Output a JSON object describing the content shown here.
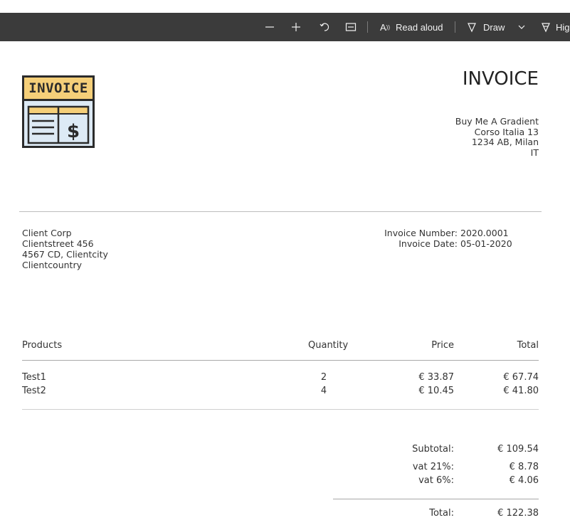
{
  "toolbar": {
    "read_aloud_label": "Read aloud",
    "draw_label": "Draw",
    "highlight_label": "Hig",
    "icons": [
      "zoom-out-icon",
      "zoom-in-icon",
      "rotate-icon",
      "fit-page-icon",
      "read-aloud-icon",
      "draw-icon",
      "chevron-down-icon",
      "highlight-icon"
    ]
  },
  "logo": {
    "text": "INVOICE",
    "accent": "#f5cf79",
    "body": "#ddeaf5"
  },
  "document": {
    "title": "INVOICE",
    "seller": {
      "name": "Buy Me A Gradient",
      "street": "Corso Italia 13",
      "city": "1234 AB, Milan",
      "country": "IT"
    },
    "client": {
      "name": "Client Corp",
      "street": "Clientstreet 456",
      "city": "4567 CD, Clientcity",
      "country": "Clientcountry"
    },
    "meta": {
      "invoice_number_label": "Invoice Number:",
      "invoice_number": "2020.0001",
      "invoice_date_label": "Invoice Date:",
      "invoice_date": "05-01-2020"
    },
    "table": {
      "headers": {
        "products": "Products",
        "quantity": "Quantity",
        "price": "Price",
        "total": "Total"
      },
      "rows": [
        {
          "product": "Test1",
          "quantity": "2",
          "price": "€ 33.87",
          "total": "€ 67.74"
        },
        {
          "product": "Test2",
          "quantity": "4",
          "price": "€ 10.45",
          "total": "€ 41.80"
        }
      ]
    },
    "totals": {
      "subtotal_label": "Subtotal:",
      "subtotal": "€ 109.54",
      "vat21_label": "vat 21%:",
      "vat21": "€ 8.78",
      "vat6_label": "vat 6%:",
      "vat6": "€ 4.06",
      "total_label": "Total:",
      "total": "€ 122.38"
    }
  }
}
